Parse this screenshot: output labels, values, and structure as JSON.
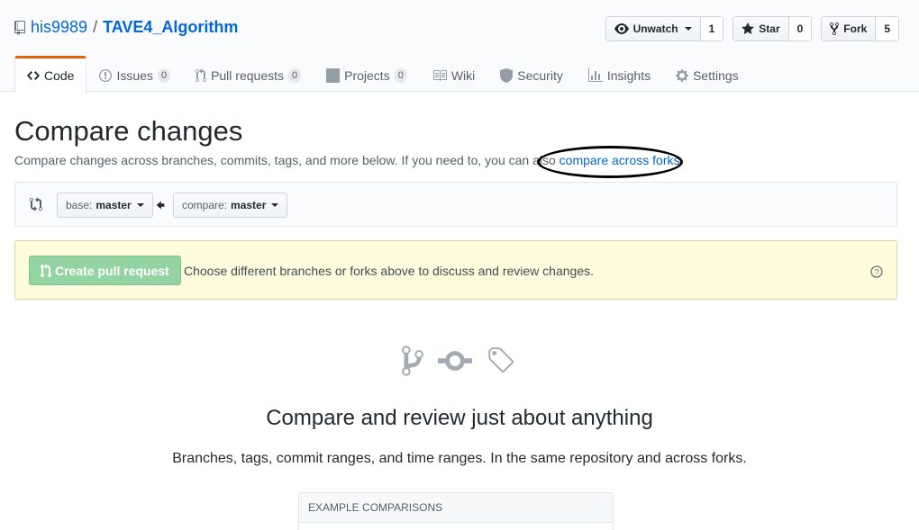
{
  "repo": {
    "owner": "his9989",
    "separator": "/",
    "name": "TAVE4_Algorithm"
  },
  "actions": {
    "watch": {
      "label": "Unwatch",
      "count": "1"
    },
    "star": {
      "label": "Star",
      "count": "0"
    },
    "fork": {
      "label": "Fork",
      "count": "5"
    }
  },
  "nav": [
    {
      "label": "Code",
      "icon": "code-icon",
      "selected": true
    },
    {
      "label": "Issues",
      "count": "0",
      "icon": "issue-icon"
    },
    {
      "label": "Pull requests",
      "count": "0",
      "icon": "pull-request-icon"
    },
    {
      "label": "Projects",
      "count": "0",
      "icon": "project-icon"
    },
    {
      "label": "Wiki",
      "icon": "book-icon"
    },
    {
      "label": "Security",
      "icon": "shield-icon"
    },
    {
      "label": "Insights",
      "icon": "graph-icon"
    },
    {
      "label": "Settings",
      "icon": "gear-icon"
    }
  ],
  "compare": {
    "title": "Compare changes",
    "description": "Compare changes across branches, commits, tags, and more below. If you need to, you can also ",
    "forks_link": "compare across forks.",
    "base": {
      "prefix": "base: ",
      "branch": "master"
    },
    "head": {
      "prefix": "compare: ",
      "branch": "master"
    }
  },
  "flash": {
    "button": "Create pull request",
    "message": "Choose different branches or forks above to discuss and review changes."
  },
  "blankslate": {
    "title": "Compare and review just about anything",
    "description": "Branches, tags, commit ranges, and time ranges. In the same repository and across forks.",
    "examples_header": "Example comparisons"
  },
  "colors": {
    "link": "#0366d6",
    "selected_tab_accent": "#e36209",
    "flash_bg": "#fffbdd",
    "disabled_green": "#94d3a2",
    "annotation_oval": "#000000"
  }
}
